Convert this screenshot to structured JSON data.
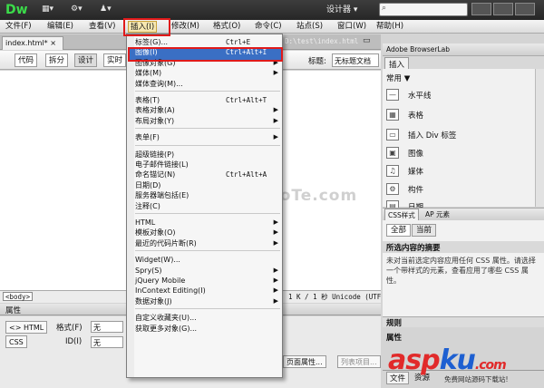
{
  "app": {
    "logo": "Dw",
    "designer": "设计器 ▾",
    "search_icon": "search-icon"
  },
  "menubar": [
    "文件(F)",
    "编辑(E)",
    "查看(V)",
    "插入(I)",
    "修改(M)",
    "格式(O)",
    "命令(C)",
    "站点(S)",
    "窗口(W)",
    "帮助(H)"
  ],
  "doc": {
    "tab": "index.html*",
    "path": "D:\\test\\index.html",
    "view_buttons": [
      "代码",
      "拆分",
      "设计",
      "实时"
    ],
    "title_label": "标题:",
    "title_value": "无标题文档"
  },
  "status": {
    "tag": "<body>",
    "info": "1 K / 1 秒 Unicode (UTF"
  },
  "insert_menu": {
    "groups": [
      [
        {
          "label": "标签(G)...",
          "shortcut": "Ctrl+E",
          "sub": false
        },
        {
          "label": "图像(I)",
          "shortcut": "Ctrl+Alt+I",
          "sub": false,
          "highlighted": true
        },
        {
          "label": "图像对象(G)",
          "shortcut": "",
          "sub": true
        },
        {
          "label": "媒体(M)",
          "shortcut": "",
          "sub": true
        },
        {
          "label": "媒体查询(M)...",
          "shortcut": "",
          "sub": false
        }
      ],
      [
        {
          "label": "表格(T)",
          "shortcut": "Ctrl+Alt+T",
          "sub": false
        },
        {
          "label": "表格对象(A)",
          "shortcut": "",
          "sub": true
        },
        {
          "label": "布局对象(Y)",
          "shortcut": "",
          "sub": true
        }
      ],
      [
        {
          "label": "表单(F)",
          "shortcut": "",
          "sub": true
        }
      ],
      [
        {
          "label": "超级链接(P)",
          "shortcut": "",
          "sub": false
        },
        {
          "label": "电子邮件链接(L)",
          "shortcut": "",
          "sub": false
        },
        {
          "label": "命名锚记(N)",
          "shortcut": "Ctrl+Alt+A",
          "sub": false
        },
        {
          "label": "日期(D)",
          "shortcut": "",
          "sub": false
        },
        {
          "label": "服务器端包括(E)",
          "shortcut": "",
          "sub": false
        },
        {
          "label": "注释(C)",
          "shortcut": "",
          "sub": false
        }
      ],
      [
        {
          "label": "HTML",
          "shortcut": "",
          "sub": true
        },
        {
          "label": "模板对象(O)",
          "shortcut": "",
          "sub": true
        },
        {
          "label": "最近的代码片断(R)",
          "shortcut": "",
          "sub": true
        }
      ],
      [
        {
          "label": "Widget(W)...",
          "shortcut": "",
          "sub": false
        },
        {
          "label": "Spry(S)",
          "shortcut": "",
          "sub": true
        },
        {
          "label": "jQuery Mobile",
          "shortcut": "",
          "sub": true
        },
        {
          "label": "InContext Editing(I)",
          "shortcut": "",
          "sub": true
        },
        {
          "label": "数据对象(J)",
          "shortcut": "",
          "sub": true
        }
      ],
      [
        {
          "label": "自定义收藏夹(U)...",
          "shortcut": "",
          "sub": false
        },
        {
          "label": "获取更多对象(G)...",
          "shortcut": "",
          "sub": false
        }
      ]
    ]
  },
  "right_panel": {
    "header": "Adobe BrowserLab",
    "insert_tab": "插入",
    "category": "常用 ▼",
    "items": [
      {
        "label": "水平线",
        "icon": "hr-icon"
      },
      {
        "label": "表格",
        "icon": "table-icon"
      },
      {
        "label": "插入 Div 标签",
        "icon": "div-icon"
      },
      {
        "label": "图像",
        "icon": "image-icon"
      },
      {
        "label": "媒体",
        "icon": "media-icon"
      },
      {
        "label": "构件",
        "icon": "widget-icon"
      },
      {
        "label": "日期",
        "icon": "date-icon"
      }
    ],
    "css_tabs": [
      "CSS样式",
      "AP 元素"
    ],
    "css_buttons": [
      "全部",
      "当前"
    ],
    "css_summary": "所选内容的摘要",
    "css_text": "未对当前选定内容应用任何 CSS 属性。请选择一个带样式的元素，查看应用了哪些 CSS 属性。",
    "rules": "规则",
    "attrs": "属性",
    "bottom_tabs": [
      "文件",
      "资源"
    ]
  },
  "properties": {
    "title": "属性",
    "html_btn": "<> HTML",
    "css_btn": "CSS",
    "format_label": "格式(F)",
    "format_value": "无",
    "id_label": "ID(I)",
    "id_value": "无",
    "page_props": "页面属性...",
    "list_item": "列表项目..."
  },
  "watermarks": {
    "site": "www.DuoTe.com",
    "brand_a": "asp",
    "brand_b": "ku",
    "brand_c": ".com",
    "sub": "免费网站源码下载站!"
  }
}
